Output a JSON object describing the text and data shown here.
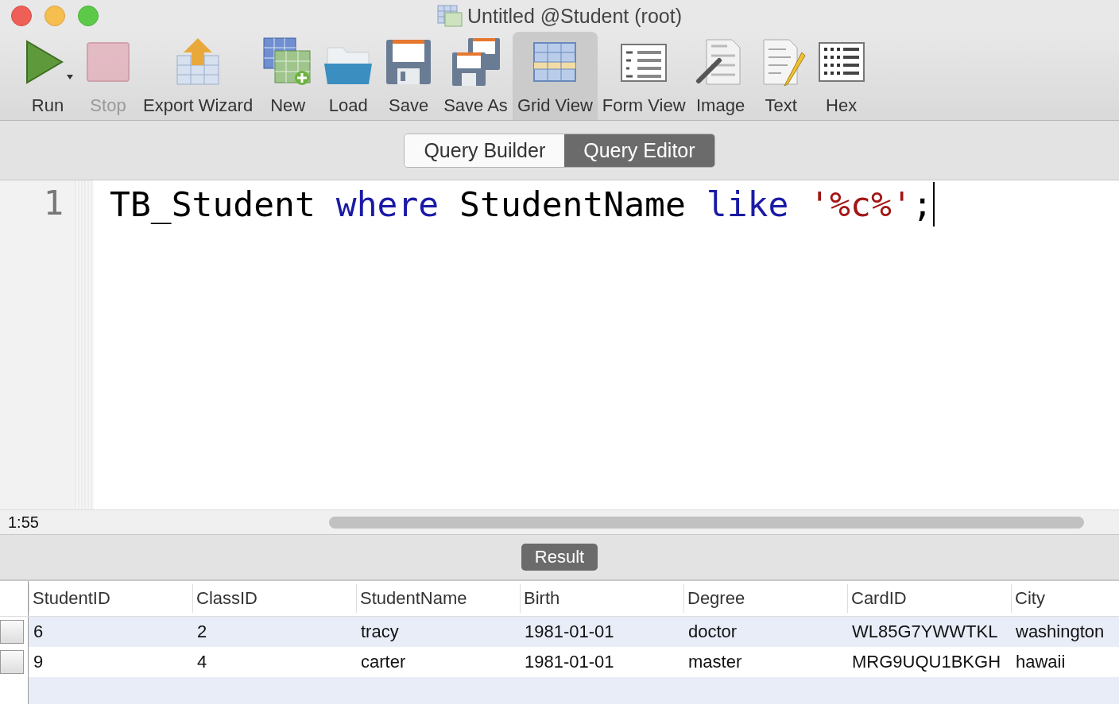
{
  "window": {
    "title": "Untitled @Student (root)"
  },
  "toolbar": [
    {
      "label": "Run",
      "kind": "run",
      "selected": false,
      "disabled": false
    },
    {
      "label": "Stop",
      "kind": "stop",
      "selected": false,
      "disabled": true
    },
    {
      "label": "Export Wizard",
      "kind": "export",
      "selected": false,
      "disabled": false
    },
    {
      "label": "New",
      "kind": "new",
      "selected": false,
      "disabled": false
    },
    {
      "label": "Load",
      "kind": "load",
      "selected": false,
      "disabled": false
    },
    {
      "label": "Save",
      "kind": "save",
      "selected": false,
      "disabled": false
    },
    {
      "label": "Save As",
      "kind": "saveas",
      "selected": false,
      "disabled": false
    },
    {
      "label": "Grid View",
      "kind": "grid",
      "selected": true,
      "disabled": false
    },
    {
      "label": "Form View",
      "kind": "form",
      "selected": false,
      "disabled": false
    },
    {
      "label": "Image",
      "kind": "image",
      "selected": false,
      "disabled": false
    },
    {
      "label": "Text",
      "kind": "text",
      "selected": false,
      "disabled": false
    },
    {
      "label": "Hex",
      "kind": "hex",
      "selected": false,
      "disabled": false
    }
  ],
  "mode_tabs": [
    {
      "label": "Query Builder",
      "selected": false
    },
    {
      "label": "Query Editor",
      "selected": true
    }
  ],
  "editor": {
    "line_numbers": [
      "1"
    ],
    "tokens": [
      {
        "text": "TB_Student ",
        "kind": "plain"
      },
      {
        "text": "where",
        "kind": "keyword"
      },
      {
        "text": " StudentName ",
        "kind": "plain"
      },
      {
        "text": "like",
        "kind": "keyword"
      },
      {
        "text": " '%c%'",
        "kind": "string"
      },
      {
        "text": ";",
        "kind": "plain"
      }
    ]
  },
  "status_bar": {
    "position": "1:55"
  },
  "result_tab": {
    "label": "Result"
  },
  "table": {
    "columns": [
      "StudentID",
      "ClassID",
      "StudentName",
      "Birth",
      "Degree",
      "CardID",
      "City"
    ],
    "rows": [
      [
        "6",
        "2",
        "tracy",
        "1981-01-01",
        "doctor",
        "WL85G7YWWTKL",
        "washington"
      ],
      [
        "9",
        "4",
        "carter",
        "1981-01-01",
        "master",
        "MRG9UQU1BKGH",
        "hawaii"
      ]
    ]
  }
}
